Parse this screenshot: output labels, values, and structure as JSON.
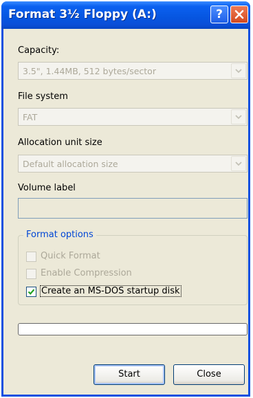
{
  "window": {
    "title": "Format 3½ Floppy (A:)",
    "help_glyph": "?",
    "icons": {
      "help": "help-icon",
      "close": "close-x-icon"
    }
  },
  "capacity": {
    "label": "Capacity:",
    "value": "3.5\",  1.44MB, 512 bytes/sector",
    "enabled": false
  },
  "file_system": {
    "label": "File system",
    "value": "FAT",
    "enabled": false
  },
  "allocation_unit": {
    "label": "Allocation unit size",
    "value": "Default allocation size",
    "enabled": false
  },
  "volume_label": {
    "label": "Volume label",
    "value": ""
  },
  "format_options": {
    "title": "Format options",
    "quick_format": {
      "label": "Quick Format",
      "checked": false,
      "enabled": false
    },
    "enable_compression": {
      "label": "Enable Compression",
      "checked": false,
      "enabled": false
    },
    "msdos_startup": {
      "label": "Create an MS-DOS startup disk",
      "checked": true,
      "enabled": true
    }
  },
  "progress": {
    "fraction": 0
  },
  "buttons": {
    "start": "Start",
    "close": "Close"
  },
  "colors": {
    "titlebar": "#0655e0",
    "dialog_bg": "#ece9d8",
    "group_title": "#0046d5",
    "disabled_text": "#aca899",
    "check_mark": "#21a121"
  }
}
